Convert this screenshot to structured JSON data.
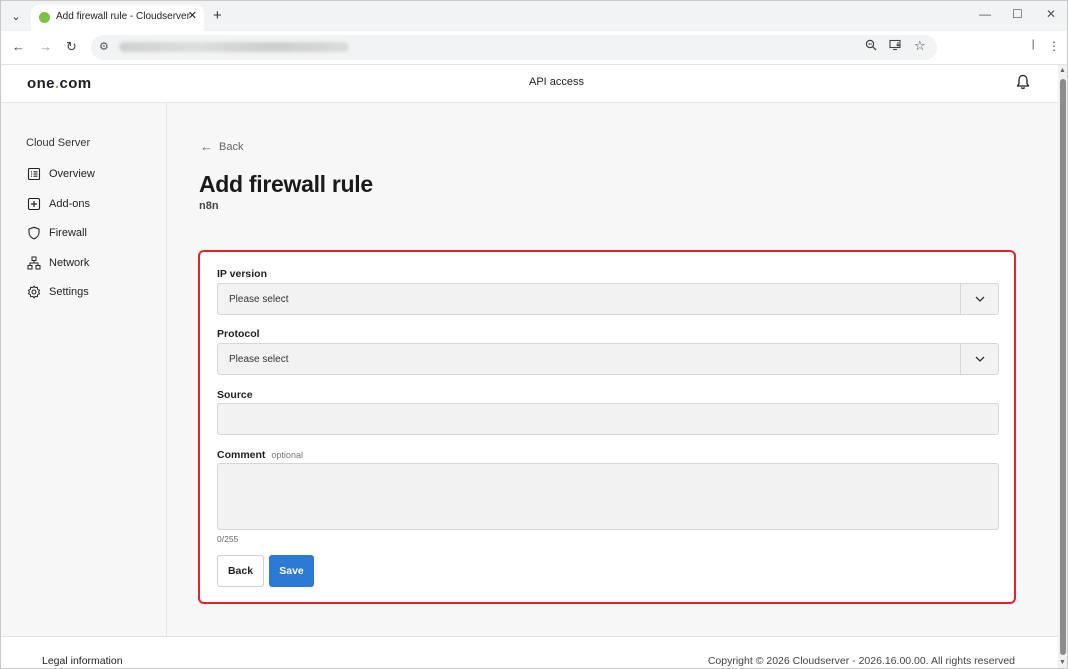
{
  "browser": {
    "tab_title": "Add firewall rule - Cloudserver",
    "tab_close": "✕",
    "new_tab": "+",
    "minimize": "—",
    "maximize": "☐",
    "close": "✕"
  },
  "header": {
    "logo_prefix": "one",
    "logo_dot": ".",
    "logo_suffix": "com",
    "api_access": "API access"
  },
  "sidebar": {
    "heading": "Cloud Server",
    "items": [
      {
        "label": "Overview",
        "icon": "list-icon"
      },
      {
        "label": "Add-ons",
        "icon": "plus-square-icon"
      },
      {
        "label": "Firewall",
        "icon": "shield-icon"
      },
      {
        "label": "Network",
        "icon": "network-icon"
      },
      {
        "label": "Settings",
        "icon": "gear-icon"
      }
    ]
  },
  "main": {
    "back_link": "Back",
    "title": "Add firewall rule",
    "subtitle": "n8n"
  },
  "form": {
    "ip_version_label": "IP version",
    "ip_version_value": "Please select",
    "protocol_label": "Protocol",
    "protocol_value": "Please select",
    "source_label": "Source",
    "source_value": "",
    "comment_label": "Comment",
    "comment_optional": "optional",
    "comment_value": "",
    "counter": "0/255",
    "back_button": "Back",
    "save_button": "Save"
  },
  "footer": {
    "legal": "Legal information",
    "copyright": "Copyright © 2026 Cloudserver - 2026.16.00.00. All rights reserved"
  },
  "colors": {
    "accent": "#2d7ad6",
    "highlight": "#e0242e",
    "brand_dot": "#7ac142"
  }
}
